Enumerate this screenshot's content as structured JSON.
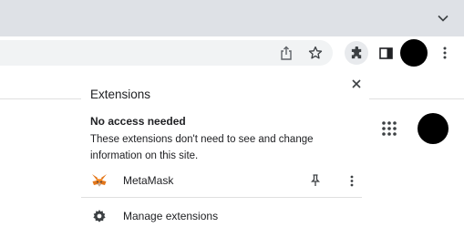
{
  "popup": {
    "title": "Extensions",
    "section_heading": "No access needed",
    "section_description": "These extensions don't need to see and change information on this site.",
    "extensions": [
      {
        "name": "MetaMask",
        "icon": "metamask-fox-icon"
      }
    ],
    "manage_label": "Manage extensions"
  },
  "colors": {
    "tabstrip_bg": "#dee1e6",
    "omnibox_bg": "#f1f3f4",
    "extension_button_active": "#e8eaed",
    "metamask_orange": "#e2761b"
  }
}
